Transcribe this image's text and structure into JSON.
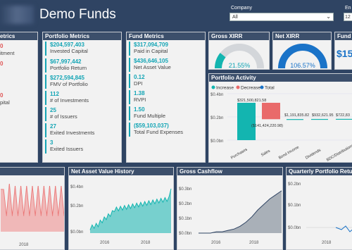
{
  "header": {
    "title": "Demo Funds"
  },
  "filters": {
    "company": {
      "label": "Company",
      "value": "All"
    },
    "end": {
      "label": "En",
      "value": "12"
    }
  },
  "metrics_left": {
    "title": "etrics",
    "labels": [
      "itment",
      "pital"
    ],
    "values": [
      "0",
      "0",
      "0"
    ]
  },
  "portfolio_metrics": {
    "title": "Portfolio Metrics",
    "items": [
      {
        "value": "$204,597,403",
        "label": "Invested Capital"
      },
      {
        "value": "$67,997,442",
        "label": "Portfolio Return"
      },
      {
        "value": "$272,594,845",
        "label": "FMV of Portfolio"
      },
      {
        "value": "112",
        "label": "# of Investments"
      },
      {
        "value": "25",
        "label": "# of Issuers"
      },
      {
        "value": "27",
        "label": "Exited Investments"
      },
      {
        "value": "3",
        "label": "Exited Issuers"
      }
    ]
  },
  "fund_metrics": {
    "title": "Fund Metrics",
    "items": [
      {
        "value": "$317,094,709",
        "label": "Paid in Capital"
      },
      {
        "value": "$436,646,105",
        "label": "Net Asset Value"
      },
      {
        "value": "0.12",
        "label": "DPI"
      },
      {
        "value": "1.38",
        "label": "RVPI"
      },
      {
        "value": "1.50",
        "label": "Fund Multiple"
      },
      {
        "value": "($59,103,037)",
        "label": "Total Fund Expenses"
      }
    ]
  },
  "gauges": {
    "gross": {
      "title": "Gross XIRR",
      "value": "21.55%",
      "fraction": 0.2155,
      "color": "#13b5b0"
    },
    "net": {
      "title": "Net XIRR",
      "value": "106.57%",
      "fraction": 1.0,
      "color": "#1a73c8"
    },
    "fund": {
      "title": "Fund M",
      "value": "$15"
    }
  },
  "portfolio_activity": {
    "title": "Portfolio Activity",
    "legend": [
      {
        "label": "Increase",
        "color": "#13b5b0"
      },
      {
        "label": "Decrease",
        "color": "#e96a6a"
      },
      {
        "label": "Total",
        "color": "#1a73c8"
      }
    ],
    "y_ticks": [
      "$0.4bn",
      "$0.2bn",
      "$0.0bn"
    ],
    "categories": [
      "Purchases",
      "Sales",
      "Bond Income",
      "Dividends",
      "BDC/Distributions"
    ],
    "data_labels": [
      "$321,500,821.58",
      "($141,424,220.98)",
      "$1,191,835.82",
      "$932,621.95",
      "$722,83"
    ]
  },
  "chart_data": [
    {
      "type": "bar",
      "title": "Portfolio Activity",
      "categories": [
        "Purchases",
        "Sales",
        "Bond Income",
        "Dividends",
        "BDC/Distributions"
      ],
      "values": [
        321500821.58,
        -141424220.98,
        1191835.82,
        932621.95,
        722830
      ],
      "ylim": [
        0,
        400000000
      ]
    },
    {
      "type": "line",
      "title": "Net Asset Value History",
      "x_ticks": [
        "2016",
        "2018"
      ],
      "y_ticks": [
        "$0.0bn",
        "$0.2bn",
        "$0.4bn"
      ],
      "ylim": [
        0,
        0.45
      ],
      "x": [
        "2015-06",
        "2016-03",
        "2016-09",
        "2017-03",
        "2017-06",
        "2017-09",
        "2018-01",
        "2018-06",
        "2019-01",
        "2019-04"
      ],
      "values": [
        0.03,
        0.06,
        0.12,
        0.2,
        0.26,
        0.28,
        0.28,
        0.3,
        0.33,
        0.42
      ]
    },
    {
      "type": "area",
      "title": "Gross Cashflow",
      "x_ticks": [
        "2016",
        "2018"
      ],
      "y_ticks": [
        "$0.0bn",
        "$0.1bn",
        "$0.2bn",
        "$0.3bn"
      ],
      "ylim": [
        0,
        0.33
      ],
      "values": [
        0.0,
        0.0,
        0.0,
        0.01,
        0.01,
        0.02,
        0.03,
        0.05,
        0.08,
        0.12,
        0.17,
        0.21,
        0.25,
        0.28,
        0.31
      ]
    },
    {
      "type": "line",
      "title": "Quarterly Portfolio Return",
      "x_ticks": [
        "2018"
      ],
      "y_ticks": [
        "$0.0bn",
        "$0.1bn",
        "$0.2bn"
      ],
      "ylim": [
        -0.02,
        0.2
      ]
    }
  ],
  "bottom_left": {
    "x_tick": "2018"
  },
  "colors": {
    "bg": "#2f4463",
    "panel": "#f2f2f2",
    "header": "#3c4f6b",
    "teal": "#13b5b0",
    "red": "#e96a6a",
    "blue": "#1a73c8"
  }
}
